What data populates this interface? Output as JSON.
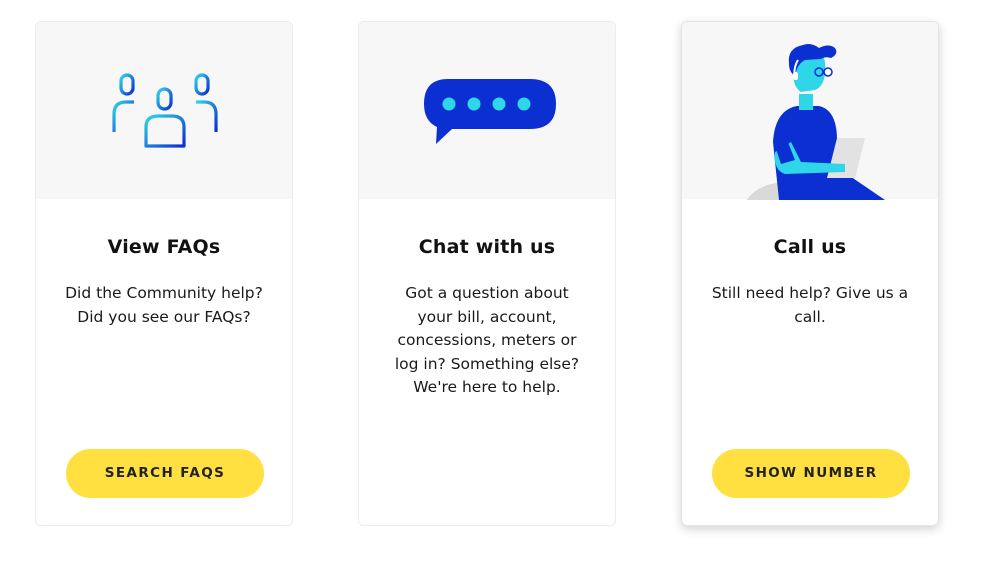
{
  "cards": [
    {
      "title": "View FAQs",
      "description": "Did the Community help? Did you see our FAQs?",
      "button_label": "SEARCH FAQS",
      "illustration": "people-group-icon"
    },
    {
      "title": "Chat with us",
      "description": "Got a question about your bill, account, concessions, meters or log in? Something else? We're here to help.",
      "button_label": "",
      "illustration": "chat-bubble-icon"
    },
    {
      "title": "Call us",
      "description": "Still need help? Give us a call.",
      "button_label": "SHOW NUMBER",
      "illustration": "support-agent-illustration"
    }
  ],
  "colors": {
    "button": "#ffe040",
    "art_background": "#f7f7f8",
    "icon_blue": "#0b2fd1",
    "icon_cyan": "#2fd6e8"
  }
}
